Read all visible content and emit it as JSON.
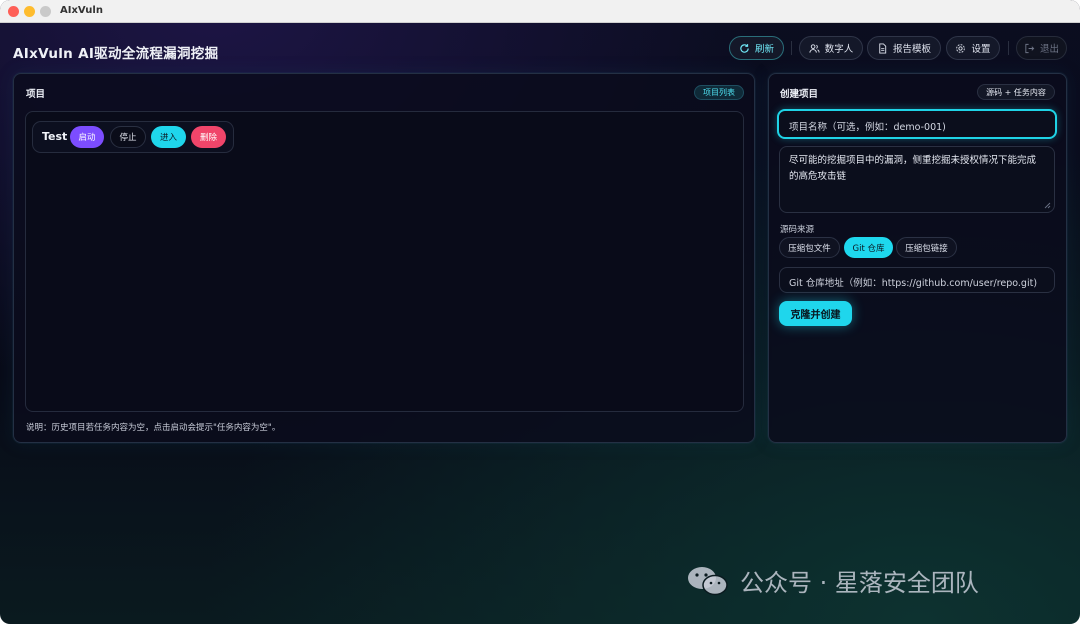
{
  "window": {
    "title": "AIxVuln"
  },
  "app": {
    "title": "AIxVuln AI驱动全流程漏洞挖掘"
  },
  "header": {
    "refresh": "刷新",
    "digital_human": "数字人",
    "report_template": "报告模板",
    "settings": "设置",
    "logout": "退出"
  },
  "projects_panel": {
    "title": "项目",
    "tag": "项目列表",
    "project": {
      "name": "Test",
      "start": "启动",
      "stop": "停止",
      "enter": "进入",
      "delete": "删除"
    },
    "note": "说明：历史项目若任务内容为空，点击启动会提示\"任务内容为空\"。"
  },
  "create_panel": {
    "title": "创建项目",
    "tag": "源码 + 任务内容",
    "name_placeholder": "项目名称（可选，例如：demo-001)",
    "task_text": "尽可能的挖掘项目中的漏洞，侧重挖掘未授权情况下能完成的高危攻击链",
    "source_label": "源码来源",
    "source_options": [
      "压缩包文件",
      "Git 仓库",
      "压缩包链接"
    ],
    "source_selected": "Git 仓库",
    "git_placeholder": "Git 仓库地址（例如：https://github.com/user/repo.git)",
    "submit": "克隆并创建"
  },
  "watermark": "公众号 · 星落安全团队",
  "colors": {
    "accent": "#1fd6ec",
    "start": "#7c4dff",
    "delete": "#f0456a",
    "enter": "#1fd6ec"
  }
}
